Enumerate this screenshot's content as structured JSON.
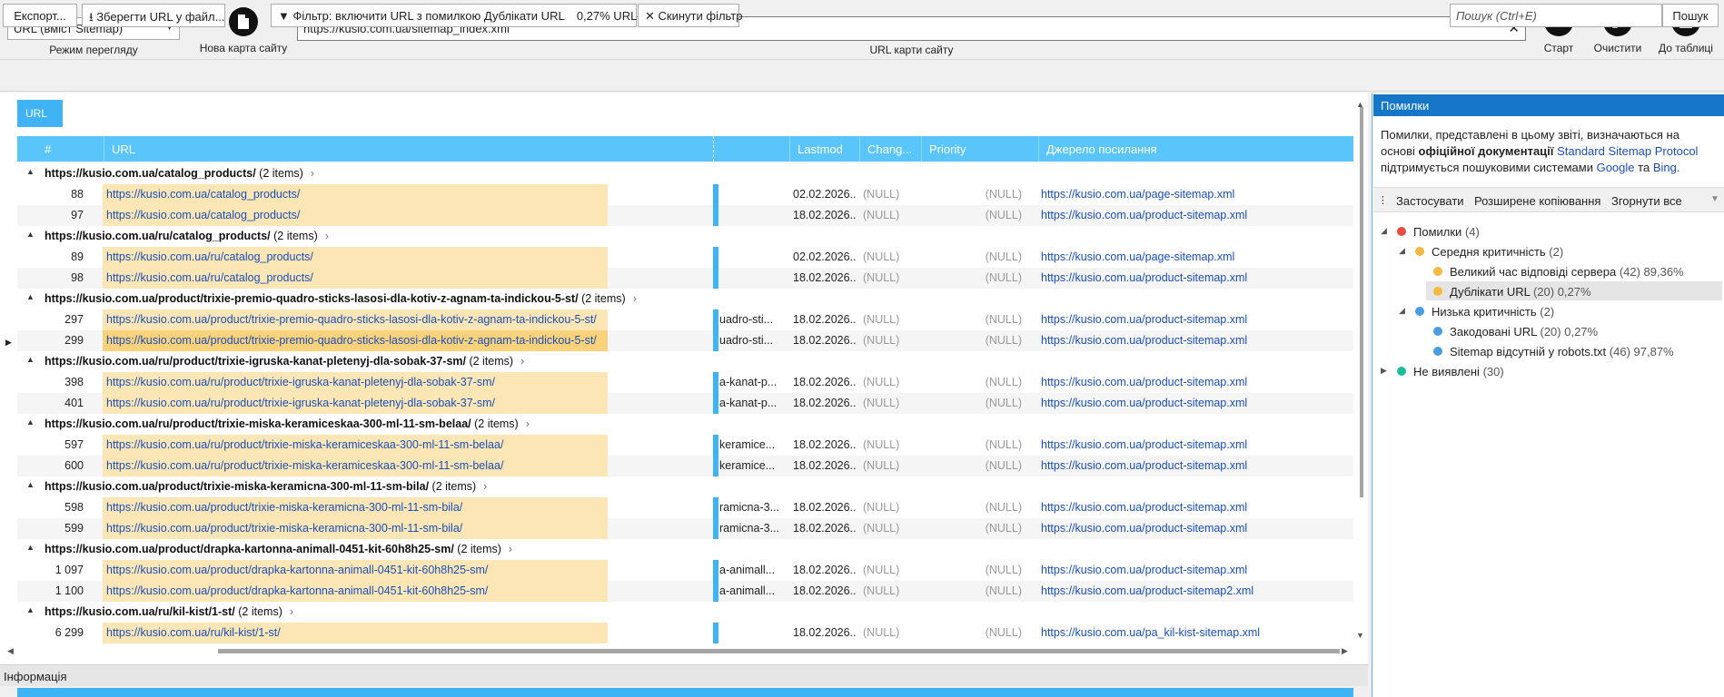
{
  "toolbar": {
    "mode_value": "URL (вміст Sitemap)",
    "mode_label": "Режим перегляду",
    "new_map_label": "Нова карта сайту",
    "url_value": "https://kusio.com.ua/sitemap_index.xml",
    "url_label": "URL карти сайту",
    "start_label": "Старт",
    "clear_label": "Очистити",
    "export_table_label": "До таблиці"
  },
  "toolbar2": {
    "export_label": "Експорт...",
    "save_url_label": "Зберегти URL у файл...",
    "filter_label": "Фільтр: включити URL з помилкою Дублікати URL",
    "filter_percent": "0,27% URLs",
    "reset_filter_label": "Скинути фільтр",
    "search_placeholder": "Пошук (Ctrl+E)",
    "search_button": "Пошук"
  },
  "grid": {
    "tab_label": "URL",
    "columns": [
      "#",
      "URL",
      "Lastmod",
      "Chang...",
      "Priority",
      "Джерело посилання"
    ],
    "groups": [
      {
        "title": "https://kusio.com.ua/catalog_products/",
        "count": "(2 items)",
        "rows": [
          {
            "num": "88",
            "url": "https://kusio.com.ua/catalog_products/",
            "path": "",
            "lastmod": "02.02.2026...",
            "changefreq": "(NULL)",
            "priority": "(NULL)",
            "source": "https://kusio.com.ua/page-sitemap.xml"
          },
          {
            "num": "97",
            "url": "https://kusio.com.ua/catalog_products/",
            "path": "",
            "lastmod": "18.02.2026...",
            "changefreq": "(NULL)",
            "priority": "(NULL)",
            "source": "https://kusio.com.ua/product-sitemap.xml"
          }
        ]
      },
      {
        "title": "https://kusio.com.ua/ru/catalog_products/",
        "count": "(2 items)",
        "rows": [
          {
            "num": "89",
            "url": "https://kusio.com.ua/ru/catalog_products/",
            "path": "",
            "lastmod": "02.02.2026...",
            "changefreq": "(NULL)",
            "priority": "(NULL)",
            "source": "https://kusio.com.ua/page-sitemap.xml"
          },
          {
            "num": "98",
            "url": "https://kusio.com.ua/ru/catalog_products/",
            "path": "",
            "lastmod": "18.02.2026...",
            "changefreq": "(NULL)",
            "priority": "(NULL)",
            "source": "https://kusio.com.ua/product-sitemap.xml"
          }
        ]
      },
      {
        "title": "https://kusio.com.ua/product/trixie-premio-quadro-sticks-lasosi-dla-kotiv-z-agnam-ta-indickou-5-st/",
        "count": "(2 items)",
        "rows": [
          {
            "num": "297",
            "url": "https://kusio.com.ua/product/trixie-premio-quadro-sticks-lasosi-dla-kotiv-z-agnam-ta-indickou-5-st/",
            "path": "uadro-sti...",
            "lastmod": "18.02.2026...",
            "changefreq": "(NULL)",
            "priority": "(NULL)",
            "source": "https://kusio.com.ua/product-sitemap.xml"
          },
          {
            "num": "299",
            "url": "https://kusio.com.ua/product/trixie-premio-quadro-sticks-lasosi-dla-kotiv-z-agnam-ta-indickou-5-st/",
            "path": "uadro-sti...",
            "lastmod": "18.02.2026...",
            "changefreq": "(NULL)",
            "priority": "(NULL)",
            "source": "https://kusio.com.ua/product-sitemap.xml"
          }
        ]
      },
      {
        "title": "https://kusio.com.ua/ru/product/trixie-igruska-kanat-pletenyj-dla-sobak-37-sm/",
        "count": "(2 items)",
        "rows": [
          {
            "num": "398",
            "url": "https://kusio.com.ua/ru/product/trixie-igruska-kanat-pletenyj-dla-sobak-37-sm/",
            "path": "a-kanat-p...",
            "lastmod": "18.02.2026...",
            "changefreq": "(NULL)",
            "priority": "(NULL)",
            "source": "https://kusio.com.ua/product-sitemap.xml"
          },
          {
            "num": "401",
            "url": "https://kusio.com.ua/ru/product/trixie-igruska-kanat-pletenyj-dla-sobak-37-sm/",
            "path": "a-kanat-p...",
            "lastmod": "18.02.2026...",
            "changefreq": "(NULL)",
            "priority": "(NULL)",
            "source": "https://kusio.com.ua/product-sitemap.xml"
          }
        ]
      },
      {
        "title": "https://kusio.com.ua/ru/product/trixie-miska-keramiceskaa-300-ml-11-sm-belaa/",
        "count": "(2 items)",
        "rows": [
          {
            "num": "597",
            "url": "https://kusio.com.ua/ru/product/trixie-miska-keramiceskaa-300-ml-11-sm-belaa/",
            "path": "keramice...",
            "lastmod": "18.02.2026...",
            "changefreq": "(NULL)",
            "priority": "(NULL)",
            "source": "https://kusio.com.ua/product-sitemap.xml"
          },
          {
            "num": "600",
            "url": "https://kusio.com.ua/ru/product/trixie-miska-keramiceskaa-300-ml-11-sm-belaa/",
            "path": "keramice...",
            "lastmod": "18.02.2026...",
            "changefreq": "(NULL)",
            "priority": "(NULL)",
            "source": "https://kusio.com.ua/product-sitemap.xml"
          }
        ]
      },
      {
        "title": "https://kusio.com.ua/product/trixie-miska-keramicna-300-ml-11-sm-bila/",
        "count": "(2 items)",
        "rows": [
          {
            "num": "598",
            "url": "https://kusio.com.ua/product/trixie-miska-keramicna-300-ml-11-sm-bila/",
            "path": "ramicna-3...",
            "lastmod": "18.02.2026...",
            "changefreq": "(NULL)",
            "priority": "(NULL)",
            "source": "https://kusio.com.ua/product-sitemap.xml"
          },
          {
            "num": "599",
            "url": "https://kusio.com.ua/product/trixie-miska-keramicna-300-ml-11-sm-bila/",
            "path": "ramicna-3...",
            "lastmod": "18.02.2026...",
            "changefreq": "(NULL)",
            "priority": "(NULL)",
            "source": "https://kusio.com.ua/product-sitemap.xml"
          }
        ]
      },
      {
        "title": "https://kusio.com.ua/product/drapka-kartonna-animall-0451-kit-60h8h25-sm/",
        "count": "(2 items)",
        "rows": [
          {
            "num": "1 097",
            "url": "https://kusio.com.ua/product/drapka-kartonna-animall-0451-kit-60h8h25-sm/",
            "path": "a-animall...",
            "lastmod": "18.02.2026...",
            "changefreq": "(NULL)",
            "priority": "(NULL)",
            "source": "https://kusio.com.ua/product-sitemap.xml"
          },
          {
            "num": "1 100",
            "url": "https://kusio.com.ua/product/drapka-kartonna-animall-0451-kit-60h8h25-sm/",
            "path": "a-animall...",
            "lastmod": "18.02.2026...",
            "changefreq": "(NULL)",
            "priority": "(NULL)",
            "source": "https://kusio.com.ua/product-sitemap2.xml"
          }
        ]
      },
      {
        "title": "https://kusio.com.ua/ru/kil-kist/1-st/",
        "count": "(2 items)",
        "rows": [
          {
            "num": "6 299",
            "url": "https://kusio.com.ua/ru/kil-kist/1-st/",
            "path": "",
            "lastmod": "18.02.2026...",
            "changefreq": "(NULL)",
            "priority": "(NULL)",
            "source": "https://kusio.com.ua/pa_kil-kist-sitemap.xml"
          }
        ]
      }
    ]
  },
  "info_panel": {
    "title": "Інформація"
  },
  "errors_panel": {
    "title": "Помилки",
    "desc_part1": "Помилки, представлені в цьому звіті, визначаються на основі ",
    "desc_bold": "офіційної документації",
    "desc_link1": "Standard Sitemap Protocol",
    "desc_part2": "підтримується пошуковими системами",
    "desc_link2": "Google",
    "desc_and": "та",
    "desc_link3": "Bing.",
    "actions": [
      "Застосувати",
      "Розширене копіювання",
      "Згорнути все"
    ],
    "tree": [
      {
        "label": "Помилки",
        "count": "(4)",
        "color": "#e74c3c",
        "level": 0,
        "twisty": "◢"
      },
      {
        "label": "Середня критичність",
        "count": "(2)",
        "color": "#f5b942",
        "level": 1,
        "twisty": "◢"
      },
      {
        "label": "Великий час відповіді сервера",
        "count": "(42) 89,36%",
        "color": "#f5b942",
        "level": 2,
        "twisty": ""
      },
      {
        "label": "Дублікати URL",
        "count": "(20) 0,27%",
        "color": "#f5b942",
        "level": 2,
        "twisty": "",
        "selected": true
      },
      {
        "label": "Низька критичність",
        "count": "(2)",
        "color": "#4a9be0",
        "level": 1,
        "twisty": "◢"
      },
      {
        "label": "Закодовані URL",
        "count": "(20) 0,27%",
        "color": "#4a9be0",
        "level": 2,
        "twisty": ""
      },
      {
        "label": "Sitemap відсутній у robots.txt",
        "count": "(46) 97,87%",
        "color": "#4a9be0",
        "level": 2,
        "twisty": ""
      },
      {
        "label": "Не виявлені",
        "count": "(30)",
        "color": "#1abc9c",
        "level": 0,
        "twisty": "▶"
      }
    ]
  }
}
